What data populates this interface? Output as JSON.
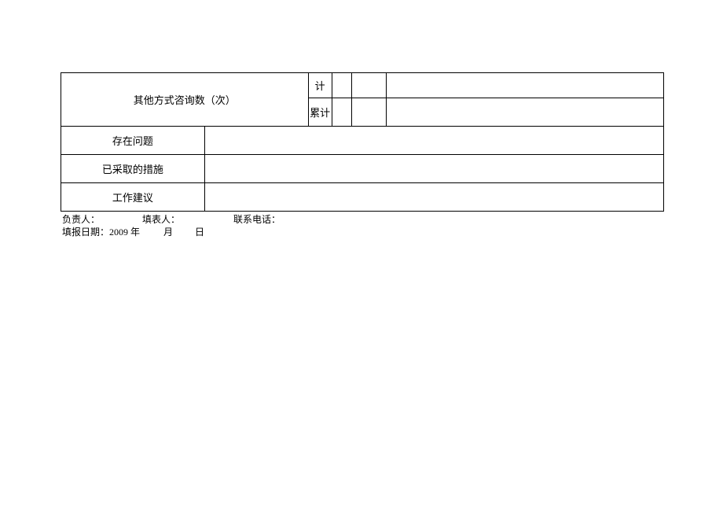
{
  "table": {
    "row1_label": "其他方式咨询数（次）",
    "ji": "计",
    "leiji": "累计",
    "problems_label": "存在问题",
    "measures_label": "已采取的措施",
    "suggestions_label": "工作建议",
    "problems_value": "",
    "measures_value": "",
    "suggestions_value": ""
  },
  "footer": {
    "responsible_label": "负责人：",
    "filler_label": "填表人：",
    "phone_label": "联系电话：",
    "date_prefix": "填报日期：2009 年",
    "month_label": "月",
    "day_label": "日"
  }
}
